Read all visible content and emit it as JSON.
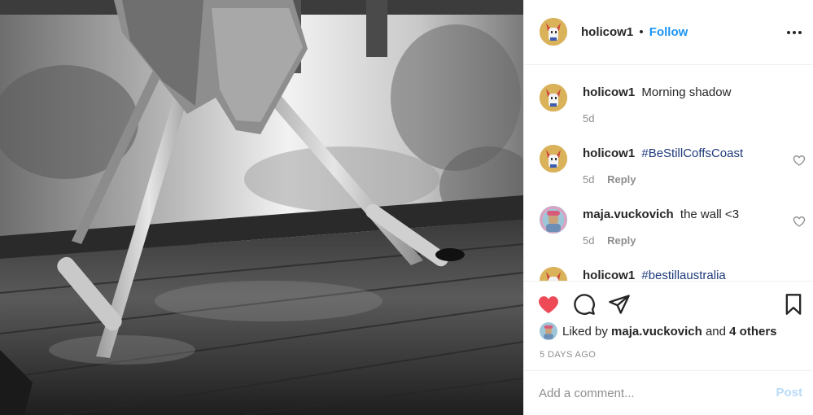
{
  "photo": {
    "description_icon": "post-photo"
  },
  "header": {
    "username": "holicow1",
    "separator": "•",
    "follow_label": "Follow",
    "more_icon": "more-horizontal-icon"
  },
  "comments": [
    {
      "username": "holicow1",
      "text": "Morning shadow",
      "hashtag": "",
      "age": "5d",
      "reply": ""
    },
    {
      "username": "holicow1",
      "text": "",
      "hashtag": "#BeStillCoffsCoast",
      "age": "5d",
      "reply": "Reply"
    },
    {
      "username": "maja.vuckovich",
      "text": "the wall <3",
      "hashtag": "",
      "age": "5d",
      "reply": "Reply"
    },
    {
      "username": "holicow1",
      "text": "",
      "hashtag": "#bestillaustralia",
      "age": "",
      "reply": ""
    }
  ],
  "actions": {
    "like_icon": "heart-filled-icon",
    "comment_icon": "comment-icon",
    "share_icon": "paper-plane-icon",
    "save_icon": "bookmark-icon",
    "like_color": "#ed4956"
  },
  "likes": {
    "prefix": "Liked by",
    "user": "maja.vuckovich",
    "conjunction": "and",
    "others": "4 others"
  },
  "timestamp": "5 DAYS AGO",
  "add_comment": {
    "placeholder": "Add a comment...",
    "post_label": "Post"
  },
  "colors": {
    "link_blue": "#1e95f4",
    "hashtag": "#1d3a7a",
    "muted": "#8e8e8e",
    "post_disabled": "#b9dbfa"
  }
}
